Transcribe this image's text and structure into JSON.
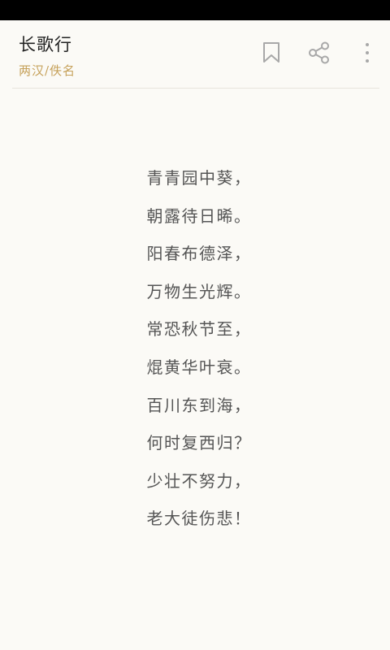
{
  "header": {
    "title": "长歌行",
    "subtitle": "两汉/佚名"
  },
  "icons": {
    "bookmark": "bookmark-icon",
    "share": "share-icon",
    "more": "more-vertical-icon"
  },
  "colors": {
    "background": "#fbfaf6",
    "accent": "#c6a15a",
    "title": "#222222",
    "poem_text": "#555555",
    "icon": "#a8a8a8"
  },
  "poem": {
    "lines": [
      "青青园中葵，",
      "朝露待日晞。",
      "阳春布德泽，",
      "万物生光辉。",
      "常恐秋节至，",
      "焜黄华叶衰。",
      "百川东到海，",
      "何时复西归？",
      "少壮不努力，",
      "老大徒伤悲！"
    ]
  }
}
